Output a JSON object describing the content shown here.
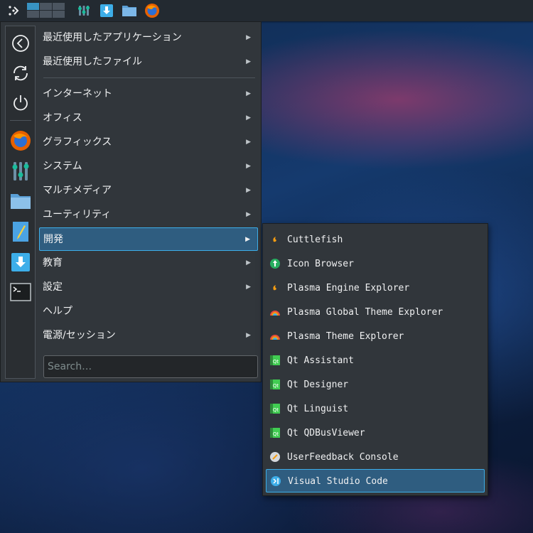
{
  "panel": {
    "icons": [
      "kickoff-launcher-icon",
      "system-settings-icon",
      "downloader-icon",
      "file-manager-icon",
      "firefox-icon"
    ]
  },
  "sidebar": {
    "items": [
      "back-icon",
      "refresh-icon",
      "power-icon",
      "firefox-icon",
      "mixer-icon",
      "folder-icon",
      "text-editor-icon",
      "downloader-icon",
      "terminal-icon"
    ]
  },
  "menu": {
    "items": [
      {
        "label": "最近使用したアプリケーション",
        "submenu": true
      },
      {
        "label": "最近使用したファイル",
        "submenu": true
      },
      {
        "label": "インターネット",
        "submenu": true
      },
      {
        "label": "オフィス",
        "submenu": true
      },
      {
        "label": "グラフィックス",
        "submenu": true
      },
      {
        "label": "システム",
        "submenu": true
      },
      {
        "label": "マルチメディア",
        "submenu": true
      },
      {
        "label": "ユーティリティ",
        "submenu": true
      },
      {
        "label": "開発",
        "submenu": true,
        "active": true
      },
      {
        "label": "教育",
        "submenu": true
      },
      {
        "label": "設定",
        "submenu": true
      },
      {
        "label": "ヘルプ",
        "submenu": false
      },
      {
        "label": "電源/セッション",
        "submenu": true
      }
    ],
    "arrow": "▶",
    "search_placeholder": "Search…"
  },
  "submenu": {
    "items": [
      {
        "label": "Cuttlefish",
        "icon": "cuttlefish-icon"
      },
      {
        "label": "Icon Browser",
        "icon": "icon-browser-icon"
      },
      {
        "label": "Plasma Engine Explorer",
        "icon": "plasma-engine-icon"
      },
      {
        "label": "Plasma Global Theme Explorer",
        "icon": "plasma-theme-icon"
      },
      {
        "label": "Plasma Theme Explorer",
        "icon": "plasma-theme-icon"
      },
      {
        "label": "Qt Assistant",
        "icon": "qt-icon"
      },
      {
        "label": "Qt Designer",
        "icon": "qt-icon"
      },
      {
        "label": "Qt Linguist",
        "icon": "qt-icon"
      },
      {
        "label": "Qt QDBusViewer",
        "icon": "qt-icon"
      },
      {
        "label": "UserFeedback Console",
        "icon": "userfeedback-icon"
      },
      {
        "label": "Visual Studio Code",
        "icon": "vscode-icon",
        "active": true
      }
    ]
  },
  "colors": {
    "accent": "#3daee9",
    "highlight_bg": "#2f5d80",
    "menu_bg": "#31363b",
    "panel_bg": "#232a31"
  }
}
